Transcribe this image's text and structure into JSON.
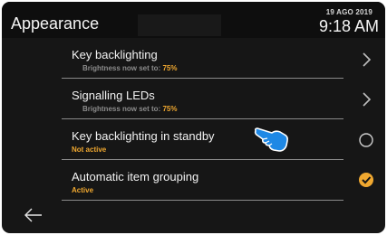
{
  "header": {
    "title": "Appearance",
    "date": "19 AGO 2019",
    "time": "9:18 AM"
  },
  "items": [
    {
      "title": "Key backlighting",
      "subtitle_prefix": "Brightness now set to:",
      "subtitle_value": "75%",
      "control": "chevron-right"
    },
    {
      "title": "Signalling LEDs",
      "subtitle_prefix": "Brightness now set to:",
      "subtitle_value": "75%",
      "control": "chevron-right"
    },
    {
      "title": "Key backlighting in standby",
      "status": "Not active",
      "control": "radio-unchecked"
    },
    {
      "title": "Automatic item grouping",
      "status": "Active",
      "control": "checkbox-checked"
    }
  ],
  "colors": {
    "background": "#161616",
    "header": "#0e0e0e",
    "accent": "#f0a830",
    "divider": "#8a8a8a",
    "hand_cursor": "#1e88e5"
  },
  "icons": {
    "back": "arrow-left-icon",
    "pointer": "pointing-hand-icon"
  }
}
